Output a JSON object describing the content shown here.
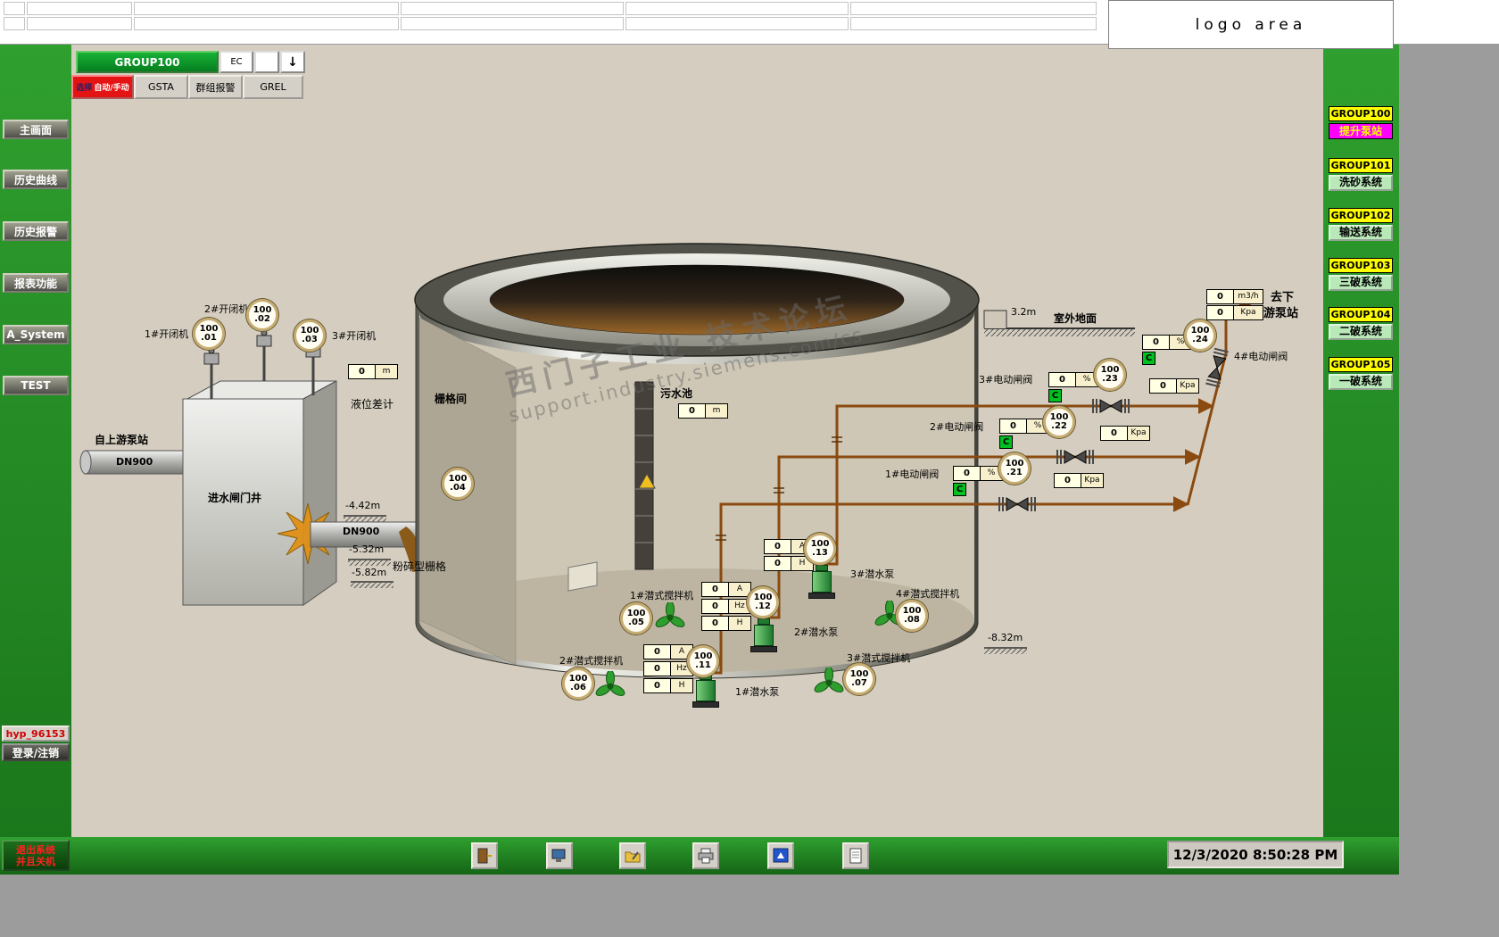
{
  "window": {
    "logo": "logo area",
    "clock": "12/3/2020 8:50:28 PM"
  },
  "toolbar": {
    "group": "GROUP100",
    "ec": "EC",
    "arrow": "↓",
    "mode_prefix": "选择",
    "mode_label": "自动/手动",
    "gsta": "GSTA",
    "group_alarm": "群组报警",
    "grel": "GREL"
  },
  "sidebar": {
    "items": [
      "主画面",
      "历史曲线",
      "历史报警",
      "报表功能",
      "A_System",
      "TEST"
    ],
    "user": "hyp_96153",
    "login": "登录/注销",
    "exit_line1": "退出系统",
    "exit_line2": "并且关机"
  },
  "groups": [
    {
      "id": "GROUP100",
      "name": "提升泵站"
    },
    {
      "id": "GROUP101",
      "name": "洗砂系统"
    },
    {
      "id": "GROUP102",
      "name": "输送系统"
    },
    {
      "id": "GROUP103",
      "name": "三破系统"
    },
    {
      "id": "GROUP104",
      "name": "二破系统"
    },
    {
      "id": "GROUP105",
      "name": "一破系统"
    }
  ],
  "diagram": {
    "upstream": "自上游泵站",
    "dn900_inlet": "DN900",
    "dn900_well": "DN900",
    "inlet_well": "进水闸门井",
    "hoists": [
      "1#开闭机",
      "2#开闭机",
      "3#开闭机"
    ],
    "level_gauge": "液位差计",
    "grid_room": "栅格间",
    "crusher_grid": "粉碎型栅格",
    "pool": "污水池",
    "outdoor_ground": "室外地面",
    "elev_ground": "3.2m",
    "elev1": "-4.42m",
    "elev2": "-5.32m",
    "elev3": "-5.82m",
    "elev4": "-8.32m",
    "pumps": [
      "1#潜水泵",
      "2#潜水泵",
      "3#潜水泵"
    ],
    "mixers": [
      "1#潜式搅拌机",
      "2#潜式搅拌机",
      "3#潜式搅拌机",
      "4#潜式搅拌机"
    ],
    "valves": [
      "1#电动闸阀",
      "2#电动闸阀",
      "3#电动闸阀",
      "4#电动闸阀"
    ],
    "dest_line1": "去下",
    "dest_line2": "游泵站",
    "c": "C"
  },
  "instruments": {
    "i01": {
      "t": "100",
      "b": ".01"
    },
    "i02": {
      "t": "100",
      "b": ".02"
    },
    "i03": {
      "t": "100",
      "b": ".03"
    },
    "i04": {
      "t": "100",
      "b": ".04"
    },
    "i05": {
      "t": "100",
      "b": ".05"
    },
    "i06": {
      "t": "100",
      "b": ".06"
    },
    "i07": {
      "t": "100",
      "b": ".07"
    },
    "i08": {
      "t": "100",
      "b": ".08"
    },
    "i11": {
      "t": "100",
      "b": ".11"
    },
    "i12": {
      "t": "100",
      "b": ".12"
    },
    "i13": {
      "t": "100",
      "b": ".13"
    },
    "i21": {
      "t": "100",
      "b": ".21"
    },
    "i22": {
      "t": "100",
      "b": ".22"
    },
    "i23": {
      "t": "100",
      "b": ".23"
    },
    "i24": {
      "t": "100",
      "b": ".24"
    }
  },
  "values": {
    "units": {
      "m": "m",
      "a": "A",
      "hz": "Hz",
      "h": "H",
      "pct": "%",
      "kpa": "Kpa",
      "m3h": "m3/h"
    },
    "level_diff": "0",
    "pool_level": "0",
    "pump3_a": "0",
    "pump3_h": "0",
    "grp1_a": "0",
    "grp1_hz": "0",
    "grp1_h": "0",
    "grp2_a": "0",
    "grp2_hz": "0",
    "grp2_h": "0",
    "valve1_pct": "0",
    "valve1_kpa": "0",
    "valve2_pct": "0",
    "valve2_kpa": "0",
    "valve3_pct": "0",
    "valve3_kpa": "0",
    "valve4_pct": "0",
    "out_flow": "0",
    "out_press": "0"
  },
  "watermark": {
    "line1": "西门子工业 技术论坛",
    "line2": "support.industry.siemens.com/cs"
  },
  "taskbar": {
    "icons": [
      "exit-door",
      "monitor",
      "folder-edit",
      "printer",
      "app-window",
      "notepad"
    ]
  }
}
